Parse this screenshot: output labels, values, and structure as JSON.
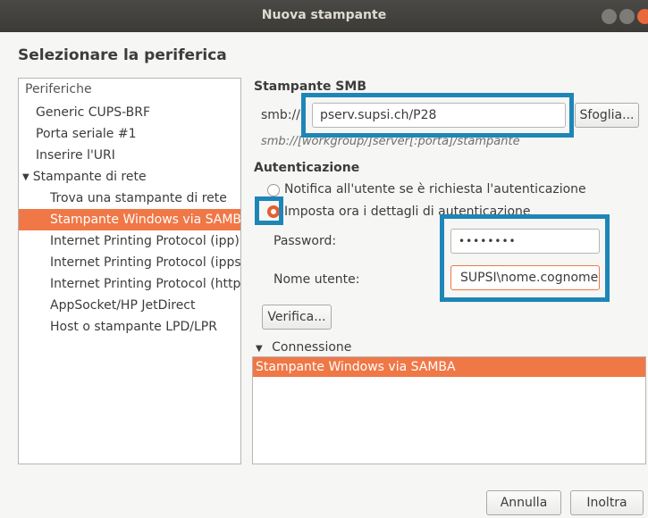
{
  "window": {
    "title": "Nuova stampante"
  },
  "heading": "Selezionare la periferica",
  "device_list": {
    "header": "Periferiche",
    "items": [
      {
        "label": "Generic CUPS-BRF",
        "level": 0
      },
      {
        "label": "Porta seriale #1",
        "level": 0
      },
      {
        "label": "Inserire l'URI",
        "level": 0
      },
      {
        "label": "Stampante di rete",
        "level": 0,
        "expanded": true
      },
      {
        "label": "Trova una stampante di rete",
        "level": 1
      },
      {
        "label": "Stampante Windows via SAMBA",
        "level": 1,
        "selected": true
      },
      {
        "label": "Internet Printing Protocol (ipp)",
        "level": 1
      },
      {
        "label": "Internet Printing Protocol (ipps)",
        "level": 1
      },
      {
        "label": "Internet Printing Protocol (https)",
        "level": 1
      },
      {
        "label": "AppSocket/HP JetDirect",
        "level": 1
      },
      {
        "label": "Host o stampante LPD/LPR",
        "level": 1
      }
    ]
  },
  "smb": {
    "section_title": "Stampante SMB",
    "prefix": "smb://",
    "uri_value": "pserv.supsi.ch/P28",
    "browse_label": "Sfoglia...",
    "hint": "smb://[workgroup/]server[:porta]/stampante"
  },
  "auth": {
    "section_title": "Autenticazione",
    "option_prompt": "Notifica all'utente se è richiesta l'autenticazione",
    "option_now": "Imposta ora i dettagli di autenticazione",
    "selected_option": "option_now",
    "password_label": "Password:",
    "password_value": "••••••••",
    "username_label": "Nome utente:",
    "username_value": "SUPSI\\nome.cognome",
    "verify_label": "Verifica..."
  },
  "connection": {
    "section_title": "Connessione",
    "items": [
      "Stampante Windows via SAMBA"
    ]
  },
  "footer": {
    "cancel_label": "Annulla",
    "forward_label": "Inoltra"
  },
  "colors": {
    "accent": "#f07746",
    "highlight": "#1e86b7",
    "titlebar": "#3c3b37"
  }
}
